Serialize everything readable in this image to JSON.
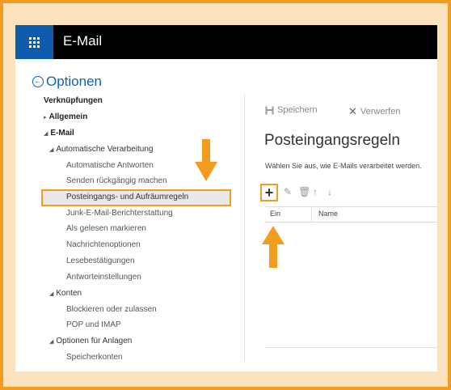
{
  "header": {
    "app_title": "E-Mail"
  },
  "back": {
    "label": "Optionen",
    "icon": "back-arrow-circle-icon"
  },
  "nav": {
    "shortcuts": "Verknüpfungen",
    "general": "Allgemein",
    "mail": "E-Mail",
    "auto_processing": "Automatische Verarbeitung",
    "items_auto": [
      "Automatische Antworten",
      "Senden rückgängig machen",
      "Posteingangs- und Aufräumregeln",
      "Junk-E-Mail-Berichterstattung",
      "Als gelesen markieren",
      "Nachrichtenoptionen",
      "Lesebestätigungen",
      "Antworteinstellungen"
    ],
    "accounts": "Konten",
    "items_accounts": [
      "Blockieren oder zulassen",
      "POP und IMAP"
    ],
    "attachments": "Optionen für Anlagen",
    "items_attachments": [
      "Speicherkonten"
    ]
  },
  "toolbar": {
    "save_label": "Speichern",
    "discard_label": "Verwerfen"
  },
  "main": {
    "title": "Posteingangsregeln",
    "description": "Wählen Sie aus, wie E-Mails verarbeitet werden.",
    "columns": [
      "Ein",
      "Name"
    ]
  },
  "colors": {
    "accent_orange": "#f39c1f",
    "waffle_blue": "#0e5cad",
    "link_blue": "#0a64b6"
  }
}
